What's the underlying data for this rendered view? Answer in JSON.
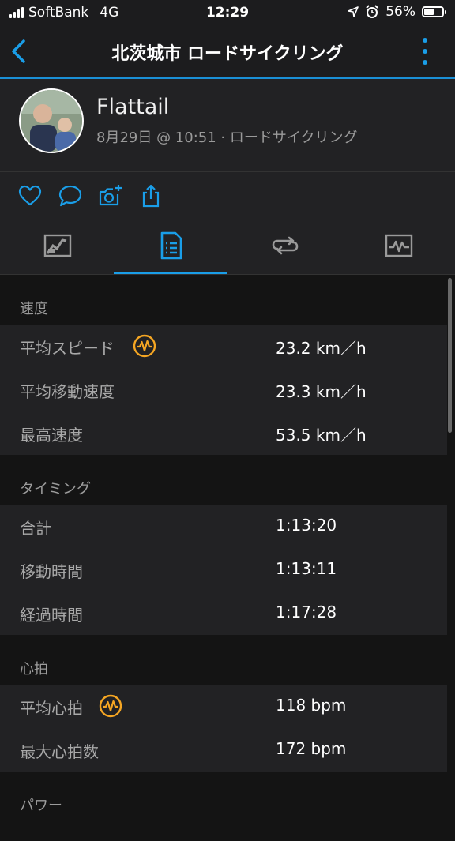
{
  "status_bar": {
    "carrier": "SoftBank",
    "network": "4G",
    "time": "12:29",
    "battery": "56%",
    "battery_level": 0.56
  },
  "nav": {
    "title": "北茨城市 ロードサイクリング"
  },
  "profile": {
    "name": "Flattail",
    "subtitle": "8月29日 @ 10:51 · ロードサイクリング"
  },
  "actions": [
    "heart-icon",
    "comment-icon",
    "add-photo-icon",
    "share-icon"
  ],
  "tabs": [
    "map-icon",
    "stats-icon",
    "laps-icon",
    "chart-icon"
  ],
  "colors": {
    "accent": "#1a9ee8",
    "badge": "#f5a623",
    "row_bg": "#222224",
    "page_bg": "#141414"
  },
  "sections": [
    {
      "title": "速度",
      "rows": [
        {
          "label": "平均スピード",
          "value": "23.2 km／h",
          "badge": true
        },
        {
          "label": "平均移動速度",
          "value": "23.3 km／h"
        },
        {
          "label": "最高速度",
          "value": "53.5 km／h"
        }
      ]
    },
    {
      "title": "タイミング",
      "rows": [
        {
          "label": "合計",
          "value": "1:13:20"
        },
        {
          "label": "移動時間",
          "value": "1:13:11"
        },
        {
          "label": "経過時間",
          "value": "1:17:28"
        }
      ]
    },
    {
      "title": "心拍",
      "rows": [
        {
          "label": "平均心拍",
          "value": "118 bpm",
          "badge": true
        },
        {
          "label": "最大心拍数",
          "value": "172 bpm"
        }
      ]
    },
    {
      "title": "パワー",
      "rows": []
    }
  ]
}
